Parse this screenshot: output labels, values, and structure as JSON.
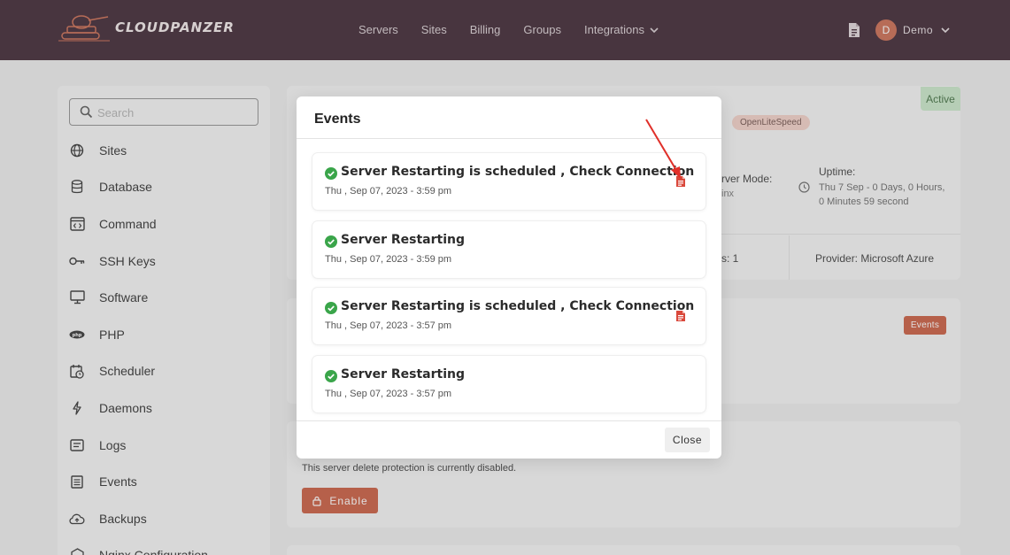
{
  "brand": {
    "name": "CLOUDPANZER"
  },
  "nav": {
    "items": [
      {
        "label": "Servers"
      },
      {
        "label": "Sites"
      },
      {
        "label": "Billing"
      },
      {
        "label": "Groups"
      },
      {
        "label": "Integrations"
      }
    ]
  },
  "user": {
    "initial": "D",
    "name": "Demo"
  },
  "sidebar": {
    "search_placeholder": "Search",
    "items": [
      {
        "label": "Sites",
        "icon": "globe-icon"
      },
      {
        "label": "Database",
        "icon": "database-icon"
      },
      {
        "label": "Command",
        "icon": "code-window-icon"
      },
      {
        "label": "SSH Keys",
        "icon": "key-icon"
      },
      {
        "label": "Software",
        "icon": "monitor-icon"
      },
      {
        "label": "PHP",
        "icon": "php-icon"
      },
      {
        "label": "Scheduler",
        "icon": "calendar-clock-icon"
      },
      {
        "label": "Daemons",
        "icon": "bolt-icon"
      },
      {
        "label": "Logs",
        "icon": "log-icon"
      },
      {
        "label": "Events",
        "icon": "list-icon"
      },
      {
        "label": "Backups",
        "icon": "cloud-upload-icon"
      },
      {
        "label": "Nginx Configuration",
        "icon": "nginx-icon"
      }
    ]
  },
  "background": {
    "status": "Active",
    "stack_pill": "OpenLiteSpeed",
    "server_mode_label": "rver Mode:",
    "server_mode_value": "inx",
    "uptime_label": "Uptime:",
    "uptime_value": "Thu 7 Sep - 0 Days, 0 Hours, 0 Minutes 59 second",
    "count_fragment": "s: 1",
    "provider_label": "Provider:",
    "provider_value": "Microsoft Azure",
    "events_button": "Events",
    "protection_text": "This server delete protection is currently disabled.",
    "enable_button": "Enable"
  },
  "modal": {
    "title": "Events",
    "close_label": "Close",
    "events": [
      {
        "title": "Server Restarting is scheduled , Check Connection",
        "date": "Thu , Sep 07, 2023 - 3:59 pm",
        "has_log": true
      },
      {
        "title": "Server Restarting",
        "date": "Thu , Sep 07, 2023 - 3:59 pm",
        "has_log": false
      },
      {
        "title": "Server Restarting is scheduled , Check Connection",
        "date": "Thu , Sep 07, 2023 - 3:57 pm",
        "has_log": true
      },
      {
        "title": "Server Restarting",
        "date": "Thu , Sep 07, 2023 - 3:57 pm",
        "has_log": false
      }
    ]
  },
  "colors": {
    "topbar": "#3b2330",
    "accent": "#c85a3e",
    "success": "#3aa54a",
    "annotation_arrow": "#e0302a"
  }
}
